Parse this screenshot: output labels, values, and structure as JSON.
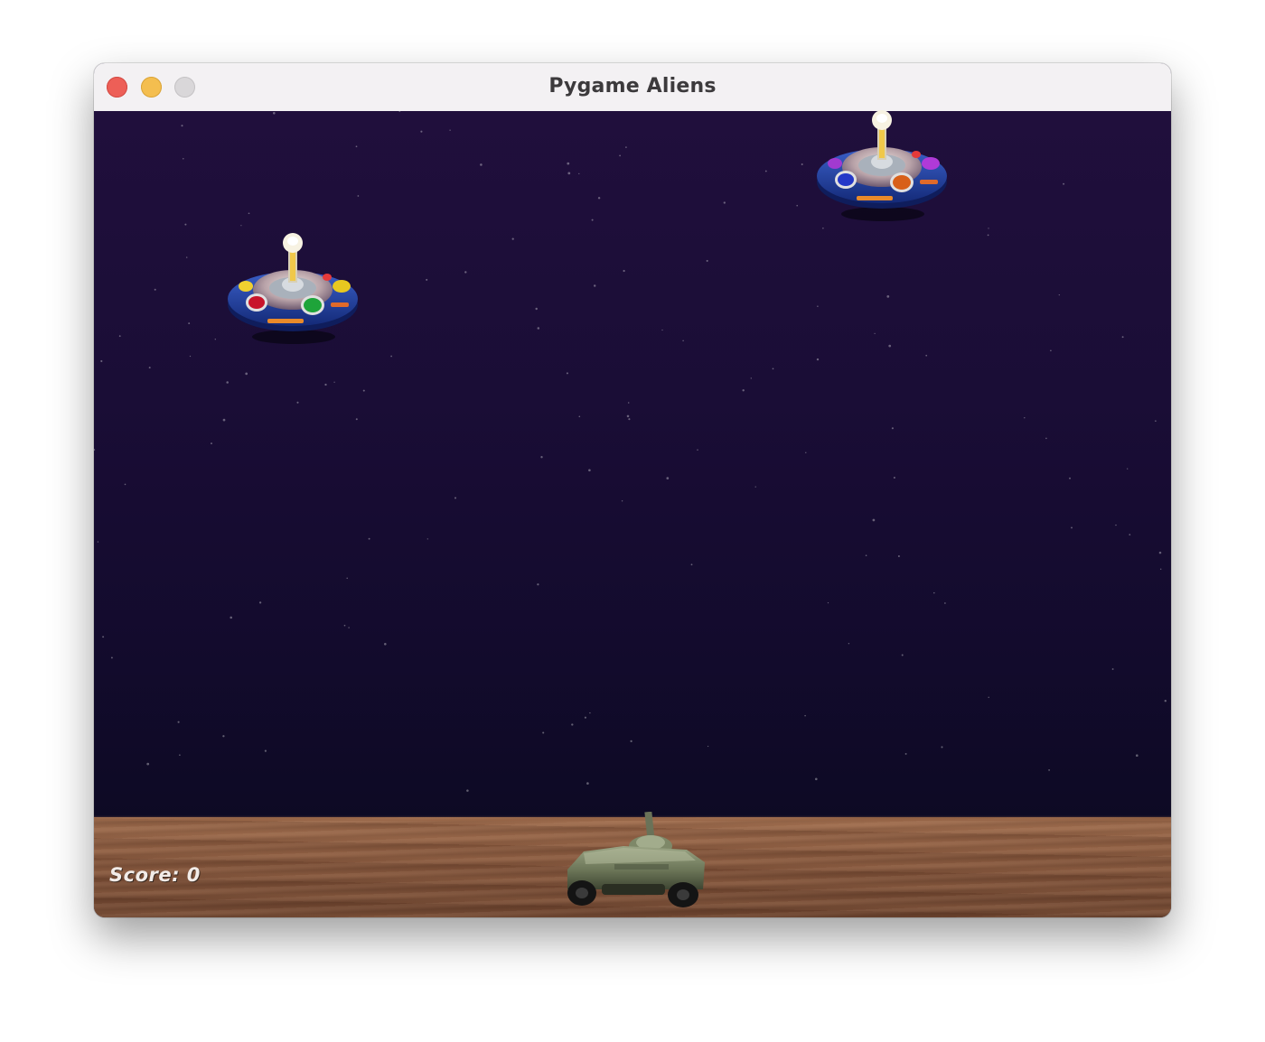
{
  "window": {
    "title": "Pygame Aliens"
  },
  "hud": {
    "score_label": "Score: 0"
  },
  "colors": {
    "sky_top": "#200f3c",
    "sky_bottom": "#0d0a24",
    "ground": "#8a5b40",
    "titlebar": "#f3f1f3",
    "close": "#ed5f57",
    "minimize": "#f4be4f",
    "maximize": "#d9d7d9"
  },
  "icons": [
    "close-icon",
    "minimize-icon",
    "zoom-icon",
    "alien-ufo-icon",
    "player-tank-icon"
  ]
}
